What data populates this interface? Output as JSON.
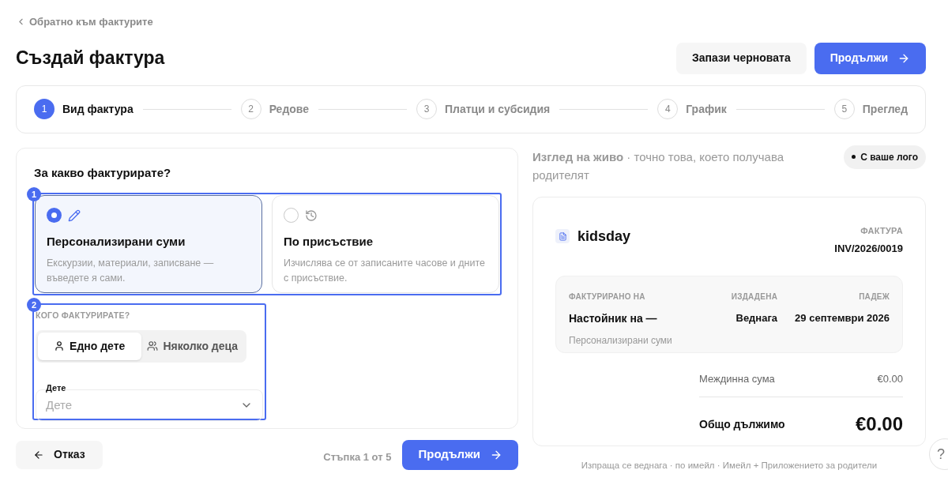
{
  "back_link": "Обратно към фактурите",
  "title": "Създай фактура",
  "header_buttons": [
    {
      "label": "Запази черновата",
      "kind": "secondary"
    },
    {
      "label": "Продължи",
      "kind": "primary"
    }
  ],
  "steps": [
    {
      "number": "1",
      "label": "Вид фактура",
      "selected": true
    },
    {
      "number": "2",
      "label": "Редове",
      "selected": false
    },
    {
      "number": "3",
      "label": "Платци и субсидия",
      "selected": false
    },
    {
      "number": "4",
      "label": "График",
      "selected": false
    },
    {
      "number": "5",
      "label": "Преглед",
      "selected": false
    }
  ],
  "form": {
    "question": "За какво фактурирате?",
    "annotations": [
      {
        "label": "1"
      },
      {
        "label": "2"
      }
    ],
    "invoice_types": [
      {
        "title": "Персонализирани суми",
        "description": "Екскурзии, материали, записване — въведете я сами.",
        "kind": "pencil",
        "selected": true
      },
      {
        "title": "По присъствие",
        "description": "Изчислява се от записаните часове и дните с присъствие.",
        "kind": "clock",
        "selected": false
      }
    ],
    "recipient_label": "КОГО ФАКТУРИРАТЕ?",
    "recipient_options": [
      {
        "label": "Едно дете",
        "kind": "single",
        "selected": true
      },
      {
        "label": "Няколко деца",
        "kind": "multiple",
        "selected": false
      }
    ],
    "child_field": {
      "label": "Дете",
      "placeholder": "Дете"
    }
  },
  "footer": {
    "cancel": "Отказ",
    "step_counter": "Стъпка 1 от 5",
    "continue": "Продължи"
  },
  "preview": {
    "heading": "**Изглед на живо** · точно това, което получава родителят",
    "badge": "С ваше лого",
    "invoice": {
      "brand": "kidsday",
      "doc_label": "ФАКТУРА",
      "number": "INV/2026/0019",
      "billed_to_label": "ФАКТУРИРАНО НА",
      "billed_to": "Настойник на —",
      "billed_to_note": "Персонализирани суми",
      "issued_label": "ИЗДАДЕНА",
      "issued": "Веднага",
      "due_label": "ПАДЕЖ",
      "due": "29 септември 2026",
      "subtotal_label": "Междинна сума",
      "subtotal": "€0.00",
      "total_label": "Общо дължимо",
      "total": "€0.00"
    },
    "note": "Изпраща се веднага · по имейл · Имейл + Приложението за родители"
  },
  "help": "?"
}
